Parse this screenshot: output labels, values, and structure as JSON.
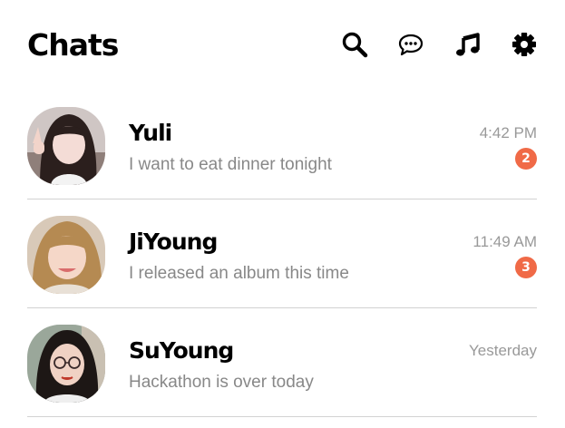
{
  "header": {
    "title": "Chats",
    "icons": [
      "search-icon",
      "chat-bubble-icon",
      "music-note-icon",
      "gear-icon"
    ]
  },
  "chats": [
    {
      "name": "Yuli",
      "message": "I want to eat dinner tonight",
      "time": "4:42 PM",
      "unread": "2"
    },
    {
      "name": "JiYoung",
      "message": "I released an album this time",
      "time": "11:49 AM",
      "unread": "3"
    },
    {
      "name": "SuYoung",
      "message": "Hackathon is over today",
      "time": "Yesterday",
      "unread": null
    }
  ],
  "colors": {
    "badge": "#f06a47",
    "meta_text": "#888888",
    "divider": "#d2d2d2"
  }
}
